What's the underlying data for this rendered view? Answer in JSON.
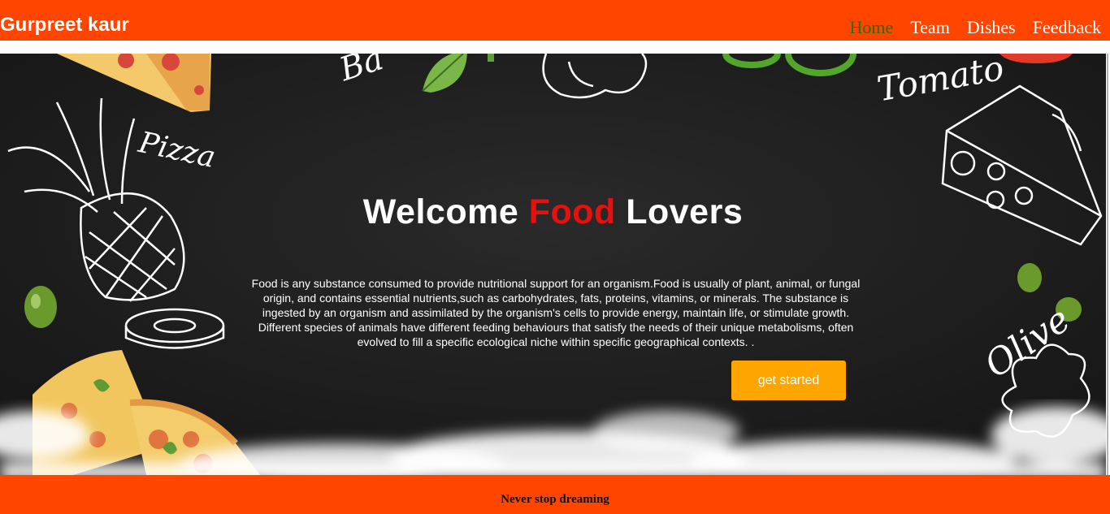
{
  "header": {
    "brand": "Gurpreet kaur",
    "nav": [
      {
        "label": "Home",
        "active": true
      },
      {
        "label": "Team",
        "active": false
      },
      {
        "label": "Dishes",
        "active": false
      },
      {
        "label": "Feedback",
        "active": false
      }
    ]
  },
  "hero": {
    "title_before": "Welcome ",
    "title_accent": "Food",
    "title_after": " Lovers",
    "description": "Food is any substance consumed to provide nutritional support for an organism.Food is usually of plant, animal, or fungal origin, and contains essential nutrients,such as carbohydrates, fats, proteins, vitamins, or minerals. The substance is ingested by an organism and assimilated by the organism's cells to provide energy, maintain life, or stimulate growth. Different species of animals have different feeding behaviours that satisfy the needs of their unique metabolisms, often evolved to fill a specific ecological niche within specific geographical contexts. .",
    "cta_label": "get started",
    "art_labels": {
      "pizza": "Pizza",
      "tomato": "Tomato",
      "olive": "Olive",
      "basil_partial": "Ba"
    },
    "art_icons": [
      "pizza-slice-icon",
      "pineapple-icon",
      "olive-icon",
      "cheese-icon",
      "tomato-icon",
      "pepper-icon",
      "basil-leaf-icon",
      "smoke-cloud"
    ]
  },
  "footer": {
    "text": "Never stop dreaming"
  },
  "colors": {
    "header_bg": "#ff4500",
    "hero_bg": "#222222",
    "accent_red": "#e8100f",
    "cta_bg": "#ffa500",
    "active_nav": "#2e6b00"
  }
}
